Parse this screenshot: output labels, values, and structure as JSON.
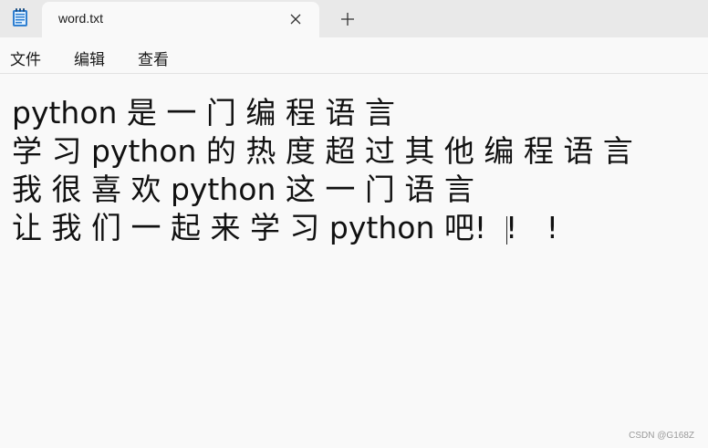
{
  "tab": {
    "title": "word.txt",
    "icon": "notepad-icon",
    "close_icon": "close-icon",
    "new_tab_icon": "plus-icon"
  },
  "menu": {
    "items": [
      "文件",
      "编辑",
      "查看"
    ]
  },
  "document": {
    "lines": [
      "python 是 一 门 编 程 语 言",
      "学 习 python 的 热 度 超 过 其 他 编 程 语 言",
      "我 很 喜 欢 python 这 一 门 语 言",
      "让 我 们 一 起 来 学 习 python 吧!  !   !"
    ]
  },
  "watermark": "CSDN @G168Z",
  "colors": {
    "tab_strip": "#e9e9e9",
    "background": "#f9f9f9",
    "text": "#111111"
  }
}
